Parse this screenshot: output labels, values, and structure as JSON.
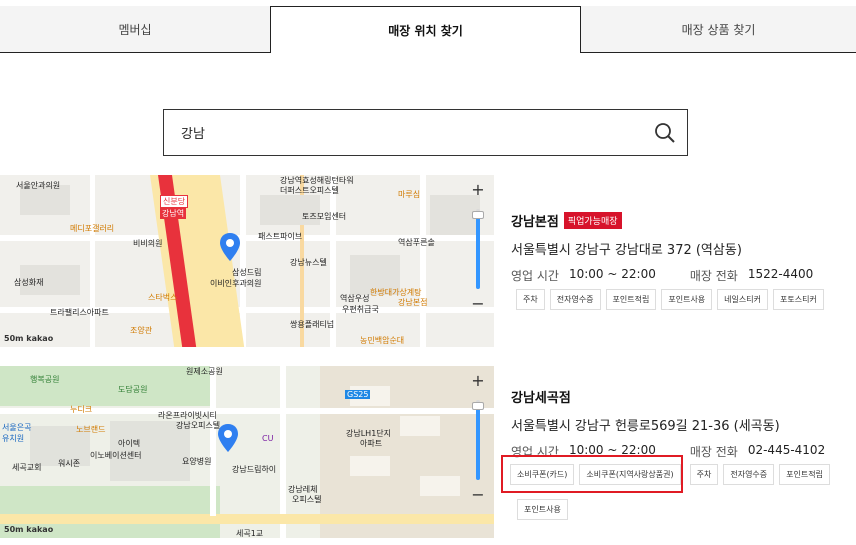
{
  "tabs": [
    {
      "label": "멤버십"
    },
    {
      "label": "매장 위치 찾기"
    },
    {
      "label": "매장 상품 찾기"
    }
  ],
  "search": {
    "value": "강남"
  },
  "map_common": {
    "scale": "50m",
    "provider": "kakao"
  },
  "map1_labels": {
    "a": "서울안과의원",
    "b": "메디포갤러리",
    "c": "비비의원",
    "d": "삼성화재",
    "e": "트라팰리스아파트",
    "f": "스타벅스",
    "g": "조양관",
    "h": "신분당",
    "i": "강남역",
    "j": "삼성드림",
    "k": "이비인후과의원",
    "l": "패스트파이브",
    "m": "토즈모임센터",
    "n": "강남뉴스텔",
    "o": "역삼우성",
    "p": "우편취급국",
    "q": "강남본점",
    "r": "쌍용플래티넘",
    "s": "한방대가상계탕",
    "t": "마루심",
    "u": "역삼푸른솔",
    "v": "농민백암순대",
    "w": "강남역효성해링턴타워",
    "x": "더퍼스트오피스텔"
  },
  "map2_labels": {
    "a": "행복공원",
    "b": "도담공원",
    "c": "누디크",
    "d": "서울은곡유치원",
    "e": "노브랜드",
    "f": "아이텍",
    "g": "이노베이션센터",
    "h": "워시존",
    "i": "세곡교회",
    "j": "라온프라이빗시티",
    "k": "강남오피스텔",
    "l": "강남드림하이",
    "m": "요양병원",
    "n": "GS25",
    "o": "강남LH1단지",
    "p": "아파트",
    "q": "강남레체",
    "r": "오피스텔",
    "s": "세곡1교",
    "t": "원제소공원",
    "u": "CU"
  },
  "stores": [
    {
      "name": "강남본점",
      "badge": "픽업가능매장",
      "address": "서울특별시 강남구 강남대로 372 (역삼동)",
      "hours_label": "영업 시간",
      "hours": "10:00 ~ 22:00",
      "phone_label": "매장 전화",
      "phone": "1522-4400",
      "tags": [
        "주차",
        "전자영수증",
        "포인트적립",
        "포인트사용",
        "네일스티커",
        "포토스티커"
      ]
    },
    {
      "name": "강남세곡점",
      "address": "서울특별시 강남구 헌릉로569길 21-36 (세곡동)",
      "hours_label": "영업 시간",
      "hours": "10:00 ~ 22:00",
      "phone_label": "매장 전화",
      "phone": "02-445-4102",
      "tags": [
        "소비쿠폰(카드)",
        "소비쿠폰(지역사랑상품권)",
        "주차",
        "전자영수증",
        "포인트적립",
        "포인트사용"
      ]
    }
  ],
  "colors": {
    "accent": "#d7132b",
    "highlight": "#e01b24",
    "zoom": "#3396ff",
    "route": "#e8323c"
  }
}
